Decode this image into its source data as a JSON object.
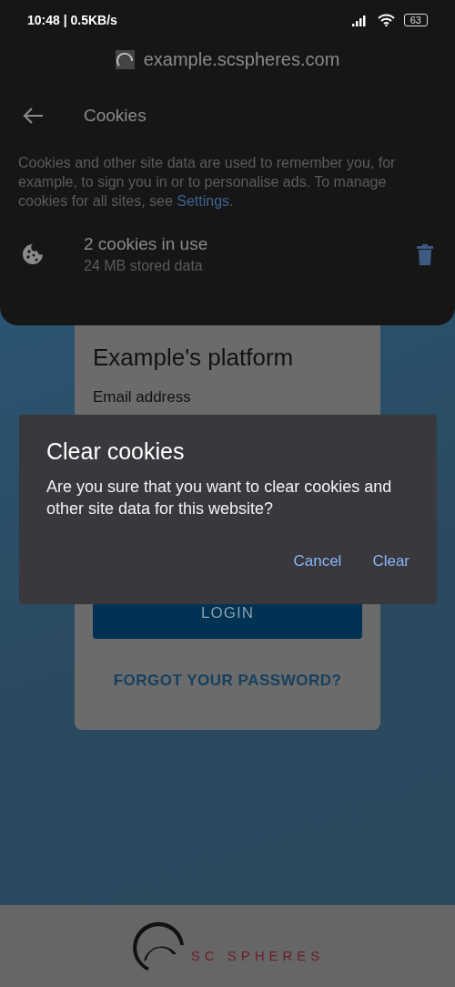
{
  "status_bar": {
    "time": "10:48 | 0.5KB/s",
    "battery": "63"
  },
  "site_sheet": {
    "url": "example.scspheres.com",
    "title": "Cookies",
    "description": {
      "text": "Cookies and other site data are used to remember you, for example, to sign you in or to personalise ads. To manage cookies for all sites, see ",
      "link": "Settings",
      "after": "."
    },
    "cookies": {
      "count": "2 cookies in use",
      "stored": "24 MB stored data"
    }
  },
  "page": {
    "card_title": "Example's platform",
    "email_label": "Email address",
    "login_button": "LOGIN",
    "forgot_link": "FORGOT YOUR PASSWORD?",
    "footer_logo": "SC SPHERES"
  },
  "dialog": {
    "title": "Clear cookies",
    "message": "Are you sure that you want to clear cookies and other site data for this website?",
    "buttons": [
      "Cancel",
      "Clear"
    ]
  }
}
